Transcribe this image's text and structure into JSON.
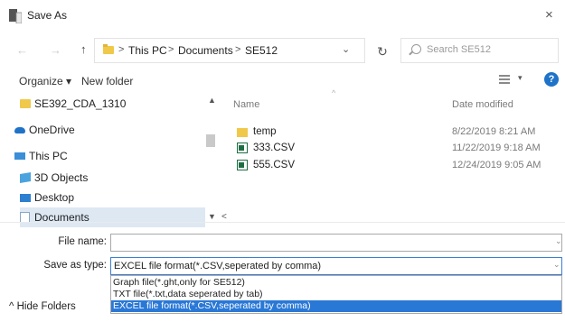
{
  "window": {
    "title": "Save As",
    "close_glyph": "×"
  },
  "nav_buttons": {
    "back": "←",
    "forward": "→",
    "up": "↑"
  },
  "address": {
    "crumbs": [
      "This PC",
      "Documents",
      "SE512"
    ],
    "separator": ">",
    "dropdown": "⌄",
    "refresh": "↻"
  },
  "search": {
    "placeholder": "Search SE512"
  },
  "commandbar": {
    "organize": "Organize ▾",
    "new_folder": "New folder",
    "view_dropdown": "▾",
    "help": "?"
  },
  "nav_pane": {
    "items": [
      {
        "label": "SE392_CDA_1310",
        "icon": "folder-icon"
      },
      {
        "label": "OneDrive",
        "icon": "onedrive-icon"
      },
      {
        "label": "This PC",
        "icon": "pc-icon"
      },
      {
        "label": "3D Objects",
        "icon": "3d-objects-icon"
      },
      {
        "label": "Desktop",
        "icon": "desktop-icon"
      },
      {
        "label": "Documents",
        "icon": "documents-icon",
        "selected": true
      }
    ],
    "scroll_up": "▲",
    "scroll_down": "▼"
  },
  "file_list": {
    "columns": {
      "name": "Name",
      "date": "Date modified",
      "sort_indicator": "^"
    },
    "rows": [
      {
        "name": "temp",
        "date": "8/22/2019 8:21 AM",
        "icon": "folder-icon"
      },
      {
        "name": "333.CSV",
        "date": "11/22/2019 9:18 AM",
        "icon": "csv-file-icon"
      },
      {
        "name": "555.CSV",
        "date": "12/24/2019 9:05 AM",
        "icon": "csv-file-icon"
      }
    ],
    "hscroll_left": "<"
  },
  "form": {
    "file_name_label": "File name:",
    "file_name_value": "",
    "save_type_label": "Save as type:",
    "save_type_value": "EXCEL file format(*.CSV,seperated by comma)",
    "dropdown_arrow": "⌄",
    "type_options": [
      "Graph file(*.ght,only for SE512)",
      "TXT file(*.txt,data seperated by tab)",
      "EXCEL file format(*.CSV,seperated by comma)"
    ],
    "selected_option_index": 2
  },
  "footer": {
    "hide_folders": "^ Hide Folders"
  }
}
